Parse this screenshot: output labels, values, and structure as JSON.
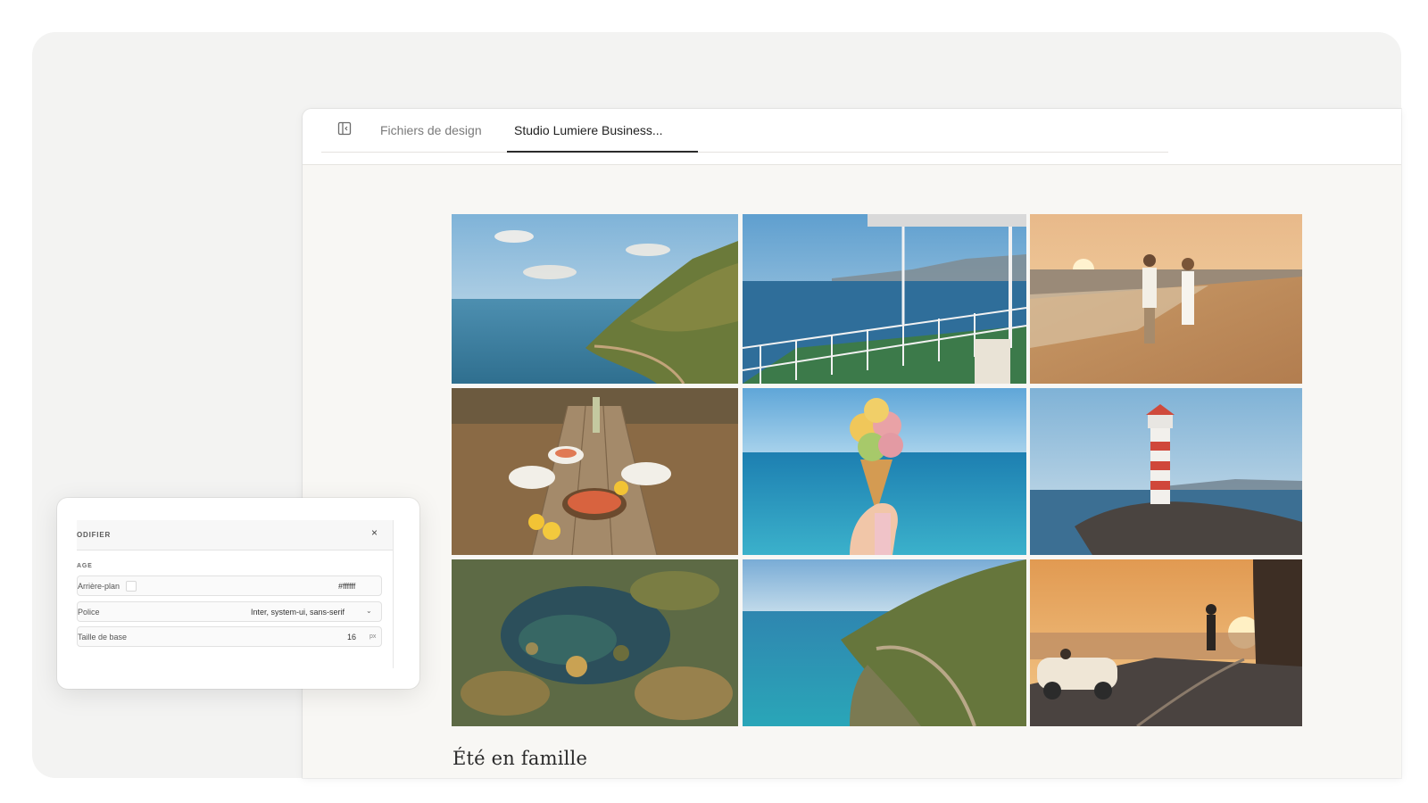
{
  "tabs": {
    "design_files": "Fichiers de design",
    "active": "Studio Lumiere Business..."
  },
  "gallery": {
    "title": "Été en famille",
    "photos": [
      {
        "name": "coastal-cliff-road-photo"
      },
      {
        "name": "ferry-deck-photo"
      },
      {
        "name": "beach-couple-sunset-photo"
      },
      {
        "name": "seafood-table-photo"
      },
      {
        "name": "ice-cream-cone-photo"
      },
      {
        "name": "lighthouse-photo"
      },
      {
        "name": "tide-pool-photo"
      },
      {
        "name": "coastal-bay-road-photo"
      },
      {
        "name": "convertible-sunset-photo"
      }
    ]
  },
  "panel": {
    "title": "ODIFIER",
    "close": "×",
    "section": "AGE",
    "fields": {
      "background": {
        "label": "Arrière-plan",
        "value": "#ffffff"
      },
      "font": {
        "label": "Police",
        "value": "Inter, system-ui, sans-serif"
      },
      "base_size": {
        "label": "Taille de base",
        "value": "16",
        "unit": "px"
      }
    }
  },
  "colors": {
    "outer_background": "#f3f3f2",
    "window_background": "#f8f7f4",
    "active_tab_underline": "#2b2b2b"
  }
}
